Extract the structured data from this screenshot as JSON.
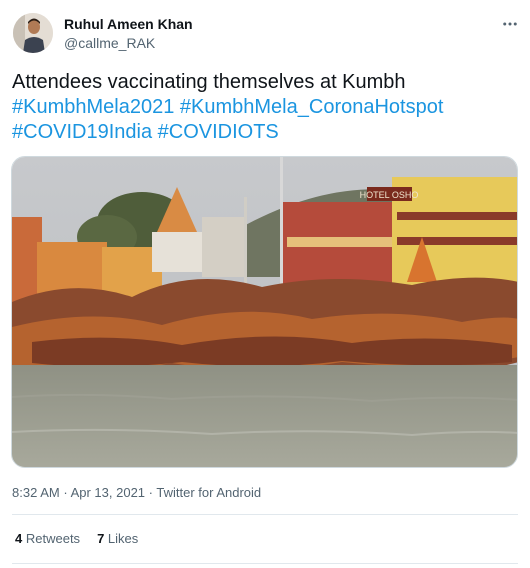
{
  "author": {
    "name": "Ruhul Ameen Khan",
    "handle": "@callme_RAK",
    "avatar_icon": "profile-photo"
  },
  "more_icon": "more-horizontal-icon",
  "tweet": {
    "text": "Attendees vaccinating themselves at Kumbh",
    "hashtags": [
      "#KumbhMela2021",
      "#KumbhMela_CoronaHotspot",
      "#COVID19India",
      "#COVIDIOTS"
    ],
    "photo_sign": "HOTEL OSHO"
  },
  "meta": {
    "time": "8:32 AM",
    "separator": "·",
    "date": "Apr 13, 2021",
    "source": "Twitter for Android"
  },
  "stats": {
    "retweets_count": "4",
    "retweets_label": "Retweets",
    "likes_count": "7",
    "likes_label": "Likes"
  },
  "colors": {
    "link": "#1b95e0",
    "secondary_text": "#536471",
    "divider": "#e1e8ed"
  }
}
